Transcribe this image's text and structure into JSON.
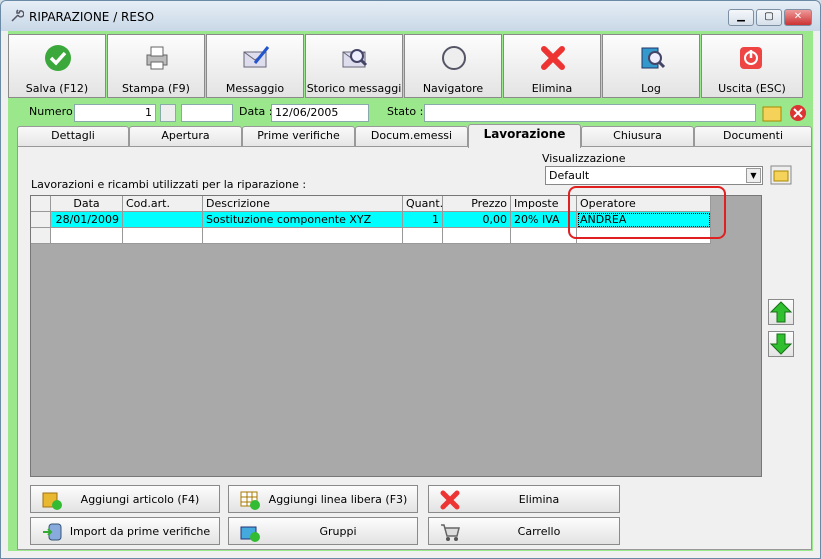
{
  "window": {
    "title": "RIPARAZIONE / RESO"
  },
  "toolbar": [
    {
      "label": "Salva (F12)",
      "icon": "check-icon"
    },
    {
      "label": "Stampa (F9)",
      "icon": "printer-icon"
    },
    {
      "label": "Messaggio",
      "icon": "envelope-pen-icon"
    },
    {
      "label": "Storico messaggi",
      "icon": "envelope-search-icon"
    },
    {
      "label": "Navigatore",
      "icon": "compass-icon"
    },
    {
      "label": "Elimina",
      "icon": "red-x-icon"
    },
    {
      "label": "Log",
      "icon": "log-icon"
    },
    {
      "label": "Uscita (ESC)",
      "icon": "power-icon"
    }
  ],
  "fields": {
    "numero_label": "Numero :",
    "numero_value": "1",
    "data_label": "Data :",
    "data_value": "12/06/2005",
    "stato_label": "Stato :",
    "stato_value": ""
  },
  "tabs": [
    "Dettagli",
    "Apertura",
    "Prime verifiche",
    "Docum.emessi",
    "Lavorazione",
    "Chiusura",
    "Documenti"
  ],
  "panel": {
    "caption": "Lavorazioni e ricambi utilizzati per la riparazione :",
    "view_group": "Visualizzazione",
    "view_value": "Default"
  },
  "table": {
    "columns": [
      "",
      "Data",
      "Cod.art.",
      "Descrizione",
      "Quant.",
      "Prezzo",
      "Imposte",
      "Operatore"
    ],
    "rows": [
      [
        "",
        "28/01/2009",
        "",
        "Sostituzione componente XYZ",
        "1",
        "0,00",
        "20% IVA",
        "ANDREA"
      ],
      [
        "",
        "",
        "",
        "",
        "",
        "",
        "",
        ""
      ]
    ]
  },
  "actions": {
    "aggiungi_articolo": "Aggiungi articolo (F4)",
    "aggiungi_linea": "Aggiungi linea libera (F3)",
    "elimina": "Elimina",
    "import": "Import da prime verifiche",
    "gruppi": "Gruppi",
    "carrello": "Carrello"
  },
  "colors": {
    "accent_green": "#9be88c",
    "row_highlight": "#00ffff",
    "annotation": "#e02020"
  }
}
